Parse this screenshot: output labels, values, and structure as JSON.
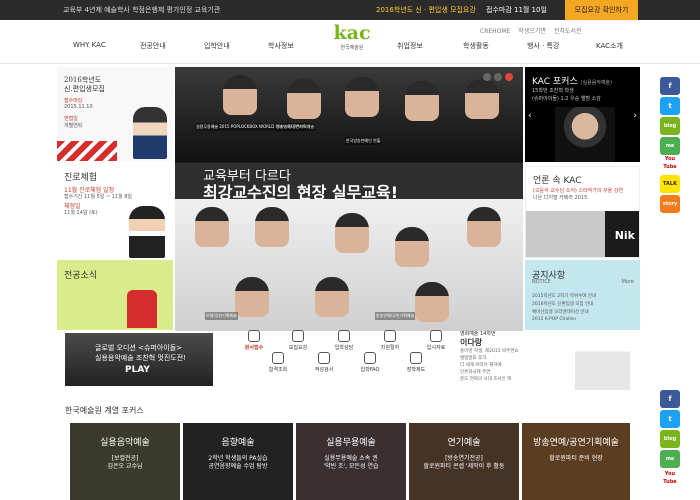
{
  "topbar": {
    "left_text": "교육부 4년제 예술학사 학점은행제 평가인정 교육기관",
    "mid_text": "2016학년도 신 · 편입생 모집요강",
    "deadline": "접수마감 11월 10일",
    "apply_button": "모집요강 확인하기"
  },
  "sublinks": [
    "CREHOME",
    "학생으기면",
    "전자도서관"
  ],
  "logo": {
    "mark": "kac",
    "name": "한국예술원"
  },
  "nav": [
    "WHY KAC",
    "전공안내",
    "입학안내",
    "학사정보",
    "취업정보",
    "학생활동",
    "행사 · 특강",
    "KAC소개"
  ],
  "left": {
    "admission": {
      "title1": "2016학년도",
      "title2": "신.편입생모집",
      "receipt_label": "접수마감",
      "receipt_date": "2015.11.10",
      "interview_label": "면접일",
      "interview_text": "개별연락"
    },
    "experience": {
      "title": "진로체험",
      "line1": "11월 진로체험 일정",
      "line2": "접수기간 11월 5일 ~ 11월 8일",
      "line3": "체험일",
      "line4": "11월 14일 (토)"
    },
    "news": {
      "title": "전공소식"
    }
  },
  "banner": {
    "headline1": "교육부터 다르다",
    "headline2": "최강교수진의 현장 실무교육!",
    "captions": [
      "실용무용예술 2015 POPLOCKBOX WORLD FINAL POPPING",
      "방송연예/공연기획예술",
      "한국방송연예인 연출",
      "보컬/공연기획예술",
      "방송연예/공연기획예술"
    ]
  },
  "right": {
    "focus": {
      "title": "KAC 포커스",
      "tag": "(실용음악예술)",
      "sub1": "15학번 조찬혁 학생",
      "sub2": "(슈퍼아이돌) 1.2 우승 앨범 소감"
    },
    "press": {
      "title": "언론 속 KAC",
      "line1": "(오윤석 교수님 소식) 스타작가의 꾸울 강연",
      "line2": "나은 디지털 카메라 2015",
      "brand": "Nik"
    },
    "notice": {
      "title": "공지사항",
      "sub": "NOTICE",
      "more": "More",
      "items": [
        "2015학년도 2학기 학위수여 안내",
        "2016학년도 신편입생 모집 안내",
        "예비신입생 오리엔테이션 안내",
        "2015 K-POP Challen"
      ]
    }
  },
  "side_icons": [
    "f",
    "t",
    "blog",
    "me",
    "You Tube",
    "TALK",
    "story"
  ],
  "promo": {
    "line1": "글로벌 오디션 <슈퍼아이돌>",
    "line2": "실용음악예술 조찬혁 멋진도전!",
    "play": "PLAY"
  },
  "quicklinks": [
    {
      "label": "원서접수",
      "highlight": true
    },
    {
      "label": "모집요강",
      "highlight": false
    },
    {
      "label": "입학상담",
      "highlight": false
    },
    {
      "label": "지원절차",
      "highlight": false
    },
    {
      "label": "입시자료",
      "highlight": false
    },
    {
      "label": "합격조회",
      "highlight": false
    },
    {
      "label": "적성검사",
      "highlight": false
    },
    {
      "label": "입학FAQ",
      "highlight": false
    },
    {
      "label": "장학제도",
      "highlight": false
    }
  ],
  "newsbox": {
    "line1": "영화예술 14학번",
    "name": "이다랑",
    "items": [
      "홍어영 학생, 제2015 박주연쇼",
      "앨범발표 후하",
      "더 세계 커리어 재하애 ",
      "인론화국제 주연",
      "준도 연화의 사대 조서인 액"
    ]
  },
  "section_title": "한국예술원 계열 포커스",
  "tiles": [
    {
      "title": "실용음악예술",
      "l1": "[보컬전공]",
      "l2": "김은오 교수님",
      "color": "#3b3b2b"
    },
    {
      "title": "음향예술",
      "l1": "2학년 학생들의 PA실습",
      "l2": "공연음향예술 수업 탐방",
      "color": "#222"
    },
    {
      "title": "실용무용예술",
      "l1": "실용무용예술 소속 권",
      "l2": "'약빈 조', 모든성 연습",
      "color": "#3a3032"
    },
    {
      "title": "연기예술",
      "l1": "[방송연기전공]",
      "l2": "할로윈파티 콘셉 '제작이 후 활동",
      "color": "#453326"
    },
    {
      "title": "방송연예/공연기획예술",
      "l1": "할로윈파티 준비 현장",
      "l2": "",
      "color": "#5b3e22"
    }
  ],
  "colors": {
    "accent_red": "#d62d2d",
    "lime": "#d9ec8c",
    "sky": "#c4e6ee",
    "logo_green": "#7ab51d",
    "apply_orange": "#f5a623"
  }
}
